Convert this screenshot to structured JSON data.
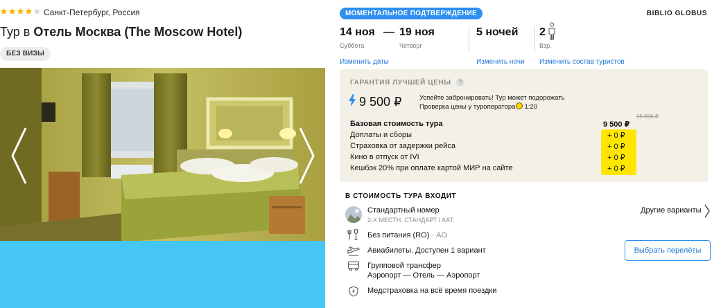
{
  "hotel": {
    "stars": 4,
    "stars_max": 5,
    "location": "Санкт-Петербург, Россия",
    "title_prefix": "Тур в",
    "title_name": "Отель Москва (The Moscow Hotel)",
    "visa_chip": "БЕЗ ВИЗЫ"
  },
  "header": {
    "instant_badge": "МОМЕНТАЛЬНОЕ ПОДТВЕРЖДЕНИЕ",
    "operator": "BIBLIO GLOBUS"
  },
  "trip": {
    "date_from": "14 ноя",
    "date_from_day": "Суббота",
    "dash": "—",
    "date_to": "19 ноя",
    "date_to_day": "Четверг",
    "nights": "5 ночей",
    "adults": "2",
    "adults_label": "Взр.",
    "link_dates": "Изменить даты",
    "link_nights": "Изменить ночи",
    "link_tourists": "Изменить состав туристов"
  },
  "price": {
    "guarantee": "ГАРАНТИЯ ЛУЧШЕЙ ЦЕНЫ",
    "help": "?",
    "main": "9 500 ₽",
    "warn_line1": "Успейте забронировать! Тур может подорожать",
    "warn_line2": "Проверка цены у туроператора",
    "warn_time": "1:20",
    "old_price": "15 656 ₽",
    "base_label": "Базовая стоимость тура",
    "base_value": "9 500 ₽",
    "extras": [
      {
        "label": "Доплаты и сборы",
        "value": "+ 0 ₽"
      },
      {
        "label": "Страховка от задержки рейса",
        "value": "+ 0 ₽"
      },
      {
        "label": "Кино в отпуск от IVI",
        "value": "+ 0 ₽"
      },
      {
        "label": "Кешбэк 20% при оплате картой МИР на сайте",
        "value": "+ 0 ₽"
      }
    ]
  },
  "included": {
    "title": "В СТОИМОСТЬ ТУРА ВХОДИТ",
    "room_name": "Стандартный номер",
    "room_sub": "2-Х МЕСТН. СТАНДАРТ I КАТ.",
    "other_variants": "Другие варианты",
    "meal": "Без питания (RO)",
    "meal_code": "· AO",
    "flights": "Авиабилеты. Доступен 1 вариант",
    "flights_button": "Выбрать перелёты",
    "transfer": "Групповой трансфер",
    "transfer_route": "Аэропорт — Отель — Аэропорт",
    "insurance": "Медстраховка на всё время поездки"
  },
  "colors": {
    "accent": "#2d8ff0",
    "link": "#1a73d6",
    "star": "#f5b800",
    "highlight": "#ffe600",
    "panel": "#f3f1e7",
    "photo_bottom": "#46c6f4"
  },
  "icons": [
    "star-icon",
    "person-icon",
    "help-icon",
    "lightning-icon",
    "clock-icon",
    "chevron-left-icon",
    "chevron-right-icon",
    "meal-icon",
    "plane-icon",
    "bus-icon",
    "shield-icon"
  ]
}
